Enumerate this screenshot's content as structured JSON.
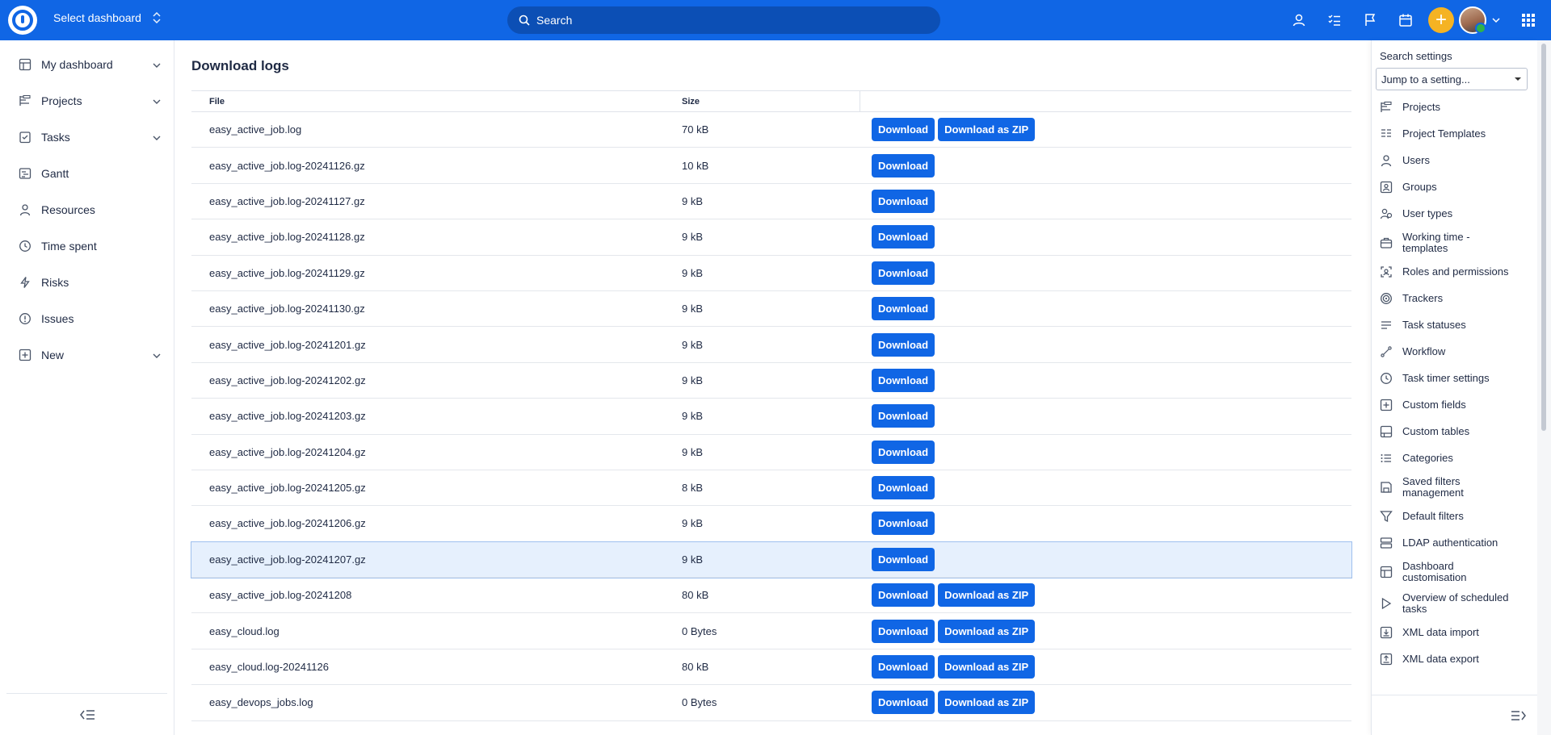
{
  "topbar": {
    "dashboard_label": "Select dashboard",
    "search_placeholder": "Search",
    "accent_color": "#1066e5",
    "plus_color": "#f5b323",
    "icons": [
      "user-icon",
      "tasks-checklist-icon",
      "flag-icon",
      "calendar-icon",
      "plus-icon",
      "avatar",
      "chevron-down-icon",
      "apps-grid-icon"
    ]
  },
  "sidebar": {
    "items": [
      {
        "label": "My dashboard",
        "icon": "dashboard-icon",
        "expandable": true
      },
      {
        "label": "Projects",
        "icon": "projects-icon",
        "expandable": true
      },
      {
        "label": "Tasks",
        "icon": "tasks-icon",
        "expandable": true
      },
      {
        "label": "Gantt",
        "icon": "gantt-icon",
        "expandable": false
      },
      {
        "label": "Resources",
        "icon": "resources-icon",
        "expandable": false
      },
      {
        "label": "Time spent",
        "icon": "clock-icon",
        "expandable": false
      },
      {
        "label": "Risks",
        "icon": "lightning-icon",
        "expandable": false
      },
      {
        "label": "Issues",
        "icon": "alert-icon",
        "expandable": false
      },
      {
        "label": "New",
        "icon": "plus-square-icon",
        "expandable": true
      }
    ]
  },
  "main": {
    "title": "Download logs",
    "columns": {
      "file": "File",
      "size": "Size"
    },
    "download_label": "Download",
    "download_zip_label": "Download as ZIP",
    "rows": [
      {
        "file": "easy_active_job.log",
        "size": "70 kB",
        "zip": true
      },
      {
        "file": "easy_active_job.log-20241126.gz",
        "size": "10 kB",
        "zip": false
      },
      {
        "file": "easy_active_job.log-20241127.gz",
        "size": "9 kB",
        "zip": false
      },
      {
        "file": "easy_active_job.log-20241128.gz",
        "size": "9 kB",
        "zip": false
      },
      {
        "file": "easy_active_job.log-20241129.gz",
        "size": "9 kB",
        "zip": false
      },
      {
        "file": "easy_active_job.log-20241130.gz",
        "size": "9 kB",
        "zip": false
      },
      {
        "file": "easy_active_job.log-20241201.gz",
        "size": "9 kB",
        "zip": false
      },
      {
        "file": "easy_active_job.log-20241202.gz",
        "size": "9 kB",
        "zip": false
      },
      {
        "file": "easy_active_job.log-20241203.gz",
        "size": "9 kB",
        "zip": false
      },
      {
        "file": "easy_active_job.log-20241204.gz",
        "size": "9 kB",
        "zip": false
      },
      {
        "file": "easy_active_job.log-20241205.gz",
        "size": "8 kB",
        "zip": false
      },
      {
        "file": "easy_active_job.log-20241206.gz",
        "size": "9 kB",
        "zip": false
      },
      {
        "file": "easy_active_job.log-20241207.gz",
        "size": "9 kB",
        "zip": false,
        "selected": true
      },
      {
        "file": "easy_active_job.log-20241208",
        "size": "80 kB",
        "zip": true
      },
      {
        "file": "easy_cloud.log",
        "size": "0 Bytes",
        "zip": true
      },
      {
        "file": "easy_cloud.log-20241126",
        "size": "80 kB",
        "zip": true
      },
      {
        "file": "easy_devops_jobs.log",
        "size": "0 Bytes",
        "zip": true
      }
    ]
  },
  "settings": {
    "title": "Search settings",
    "jump_placeholder": "Jump to a setting...",
    "items": [
      {
        "label": "Projects",
        "icon": "projects-icon",
        "lines": 1
      },
      {
        "label": "Project Templates",
        "icon": "project-templates-icon",
        "lines": 1
      },
      {
        "label": "Users",
        "icon": "user-icon",
        "lines": 1
      },
      {
        "label": "Groups",
        "icon": "groups-icon",
        "lines": 1
      },
      {
        "label": "User types",
        "icon": "user-types-icon",
        "lines": 1
      },
      {
        "label": "Working time - templates",
        "icon": "briefcase-icon",
        "lines": 2
      },
      {
        "label": "Roles and permissions",
        "icon": "roles-icon",
        "lines": 1
      },
      {
        "label": "Trackers",
        "icon": "target-icon",
        "lines": 1
      },
      {
        "label": "Task statuses",
        "icon": "statuses-icon",
        "lines": 1
      },
      {
        "label": "Workflow",
        "icon": "workflow-icon",
        "lines": 1
      },
      {
        "label": "Task timer settings",
        "icon": "clock-icon",
        "lines": 1
      },
      {
        "label": "Custom fields",
        "icon": "plus-square-icon",
        "lines": 1
      },
      {
        "label": "Custom tables",
        "icon": "table-icon",
        "lines": 1
      },
      {
        "label": "Categories",
        "icon": "categories-icon",
        "lines": 1
      },
      {
        "label": "Saved filters management",
        "icon": "save-icon",
        "lines": 2
      },
      {
        "label": "Default filters",
        "icon": "filter-icon",
        "lines": 1
      },
      {
        "label": "LDAP authentication",
        "icon": "server-icon",
        "lines": 1
      },
      {
        "label": "Dashboard customisation",
        "icon": "dashboard-icon",
        "lines": 2
      },
      {
        "label": "Overview of scheduled tasks",
        "icon": "play-icon",
        "lines": 2
      },
      {
        "label": "XML data import",
        "icon": "import-icon",
        "lines": 1
      },
      {
        "label": "XML data export",
        "icon": "export-icon",
        "lines": 1
      }
    ]
  }
}
